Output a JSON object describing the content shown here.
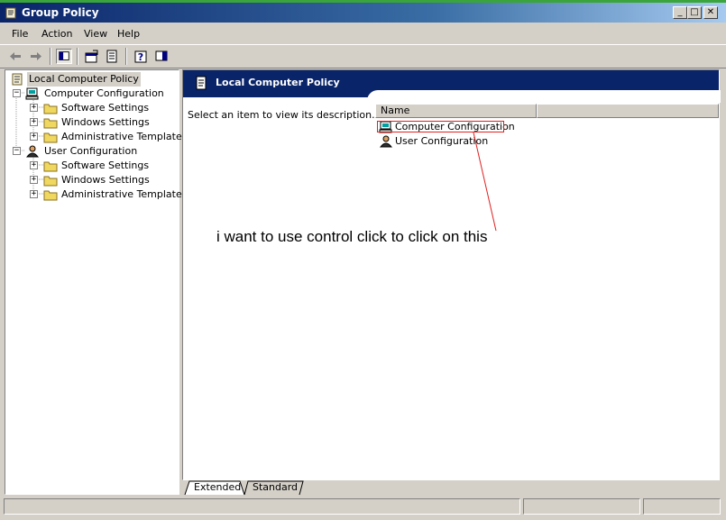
{
  "window": {
    "title": "Group Policy",
    "buttons": {
      "minimize": "_",
      "maximize": "□",
      "close": "✕"
    }
  },
  "menu": [
    "File",
    "Action",
    "View",
    "Help"
  ],
  "toolbar": {
    "icons": [
      "back-arrow-icon",
      "forward-arrow-icon",
      "show-hide-tree-icon",
      "properties-icon",
      "export-list-icon",
      "help-icon",
      "show-hide-description-icon"
    ]
  },
  "tree": {
    "root": "Local Computer Policy",
    "computer": {
      "label": "Computer Configuration",
      "children": [
        "Software Settings",
        "Windows Settings",
        "Administrative Templates"
      ]
    },
    "user": {
      "label": "User Configuration",
      "children": [
        "Software Settings",
        "Windows Settings",
        "Administrative Templates"
      ]
    }
  },
  "details": {
    "banner_title": "Local Computer Policy",
    "description": "Select an item to view its description.",
    "column_name": "Name",
    "items": [
      "Computer Configuration",
      "User Configuration"
    ]
  },
  "annotation": {
    "text": "i want to use control click to click on this",
    "color": "#e02020"
  },
  "tabs": [
    "Extended",
    "Standard"
  ],
  "colors": {
    "title_bar": "#0a246a",
    "banner": "#0a246a",
    "face": "#d4d0c8"
  }
}
